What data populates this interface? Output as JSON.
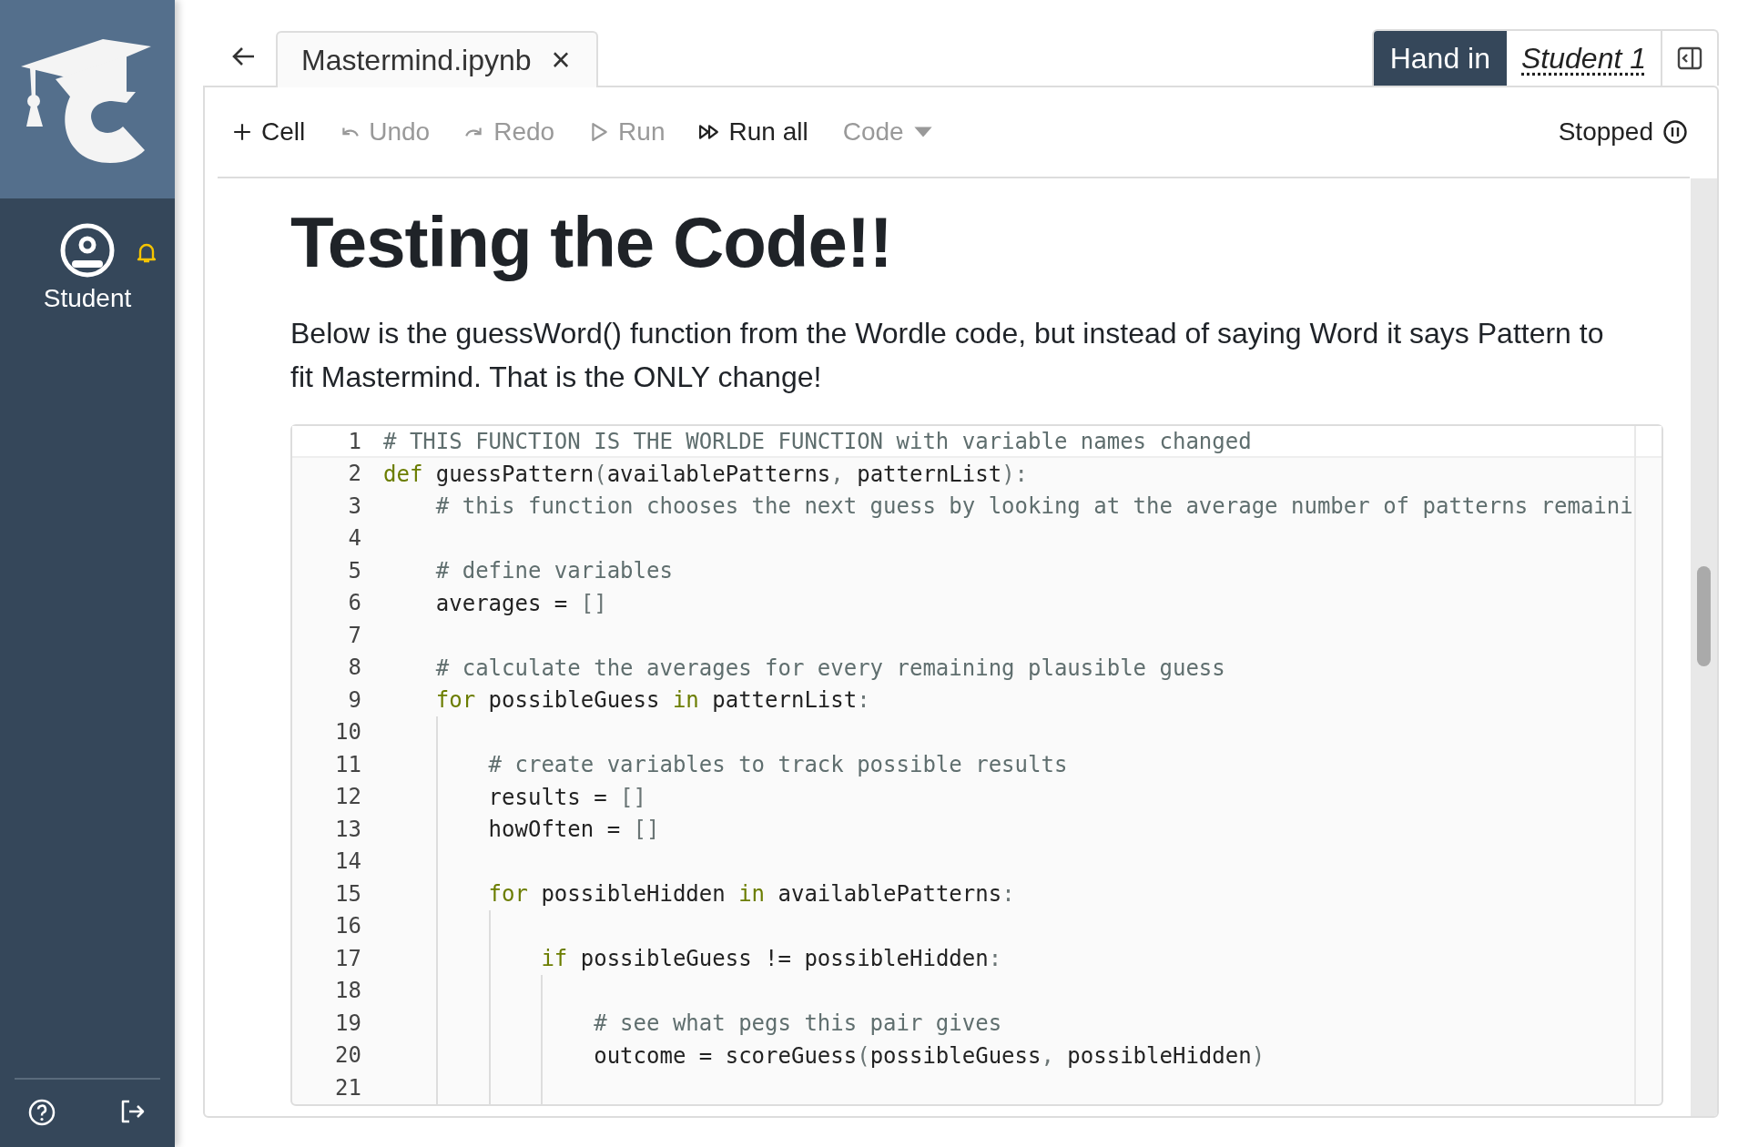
{
  "sidebar": {
    "user": {
      "label": "Student",
      "notification": true
    }
  },
  "tab": {
    "title": "Mastermind.ipynb",
    "close": "×"
  },
  "header": {
    "hand_in": "Hand in",
    "student": "Student 1"
  },
  "toolbar": {
    "items": [
      {
        "kind": "add",
        "label": "Cell",
        "disabled": false
      },
      {
        "kind": "undo",
        "label": "Undo",
        "disabled": true
      },
      {
        "kind": "redo",
        "label": "Redo",
        "disabled": true
      },
      {
        "kind": "run",
        "label": "Run",
        "disabled": true
      },
      {
        "kind": "run-all",
        "label": "Run all",
        "disabled": false
      },
      {
        "kind": "dropdown",
        "label": "Code",
        "disabled": true
      }
    ],
    "status": "Stopped"
  },
  "notebook": {
    "heading": "Testing the Code!!",
    "paragraph": "Below is the guessWord() function from the Wordle code, but instead of saying Word it says Pattern to fit Mastermind. That is the ONLY change!",
    "code_lines": [
      {
        "number": "1",
        "active": true,
        "tokens": [
          {
            "kind": "comment",
            "text": "# THIS FUNCTION IS THE WORLDE FUNCTION with variable names changed"
          }
        ]
      },
      {
        "number": "2",
        "active": false,
        "tokens": [
          {
            "kind": "keyword",
            "text": "def"
          },
          {
            "kind": "text",
            "text": " guessPattern"
          },
          {
            "kind": "punct",
            "text": "("
          },
          {
            "kind": "text",
            "text": "availablePatterns"
          },
          {
            "kind": "punct",
            "text": ","
          },
          {
            "kind": "text",
            "text": " patternList"
          },
          {
            "kind": "punct",
            "text": "):"
          }
        ]
      },
      {
        "number": "3",
        "active": false,
        "tokens": [
          {
            "kind": "comment",
            "text": "    # this function chooses the next guess by looking at the average number of patterns remaini"
          }
        ]
      },
      {
        "number": "4",
        "active": false
      },
      {
        "number": "5",
        "active": false,
        "tokens": [
          {
            "kind": "comment",
            "text": "    # define variables"
          }
        ]
      },
      {
        "number": "6",
        "active": false,
        "tokens": [
          {
            "kind": "text",
            "text": "    averages = "
          },
          {
            "kind": "punct",
            "text": "[]"
          }
        ]
      },
      {
        "number": "7",
        "active": false
      },
      {
        "number": "8",
        "active": false,
        "tokens": [
          {
            "kind": "comment",
            "text": "    # calculate the averages for every remaining plausible guess"
          }
        ]
      },
      {
        "number": "9",
        "active": false,
        "tokens": [
          {
            "kind": "keyword",
            "text": "    for"
          },
          {
            "kind": "text",
            "text": " possibleGuess "
          },
          {
            "kind": "keyword",
            "text": "in"
          },
          {
            "kind": "text",
            "text": " patternList"
          },
          {
            "kind": "punct",
            "text": ":"
          }
        ]
      },
      {
        "number": "10",
        "active": false
      },
      {
        "number": "11",
        "active": false,
        "tokens": [
          {
            "kind": "comment",
            "text": "        # create variables to track possible results"
          }
        ]
      },
      {
        "number": "12",
        "active": false,
        "tokens": [
          {
            "kind": "text",
            "text": "        results = "
          },
          {
            "kind": "punct",
            "text": "[]"
          }
        ]
      },
      {
        "number": "13",
        "active": false,
        "tokens": [
          {
            "kind": "text",
            "text": "        howOften = "
          },
          {
            "kind": "punct",
            "text": "[]"
          }
        ]
      },
      {
        "number": "14",
        "active": false
      },
      {
        "number": "15",
        "active": false,
        "tokens": [
          {
            "kind": "keyword",
            "text": "        for"
          },
          {
            "kind": "text",
            "text": " possibleHidden "
          },
          {
            "kind": "keyword",
            "text": "in"
          },
          {
            "kind": "text",
            "text": " availablePatterns"
          },
          {
            "kind": "punct",
            "text": ":"
          }
        ]
      },
      {
        "number": "16",
        "active": false
      },
      {
        "number": "17",
        "active": false,
        "tokens": [
          {
            "kind": "keyword",
            "text": "            if"
          },
          {
            "kind": "text",
            "text": " possibleGuess != possibleHidden"
          },
          {
            "kind": "punct",
            "text": ":"
          }
        ]
      },
      {
        "number": "18",
        "active": false
      },
      {
        "number": "19",
        "active": false,
        "tokens": [
          {
            "kind": "comment",
            "text": "                # see what pegs this pair gives"
          }
        ]
      },
      {
        "number": "20",
        "active": false,
        "tokens": [
          {
            "kind": "text",
            "text": "                outcome = scoreGuess"
          },
          {
            "kind": "punct",
            "text": "("
          },
          {
            "kind": "text",
            "text": "possibleGuess"
          },
          {
            "kind": "punct",
            "text": ","
          },
          {
            "kind": "text",
            "text": " possibleHidden"
          },
          {
            "kind": "punct",
            "text": ")"
          }
        ]
      },
      {
        "number": "21",
        "active": false
      }
    ]
  }
}
